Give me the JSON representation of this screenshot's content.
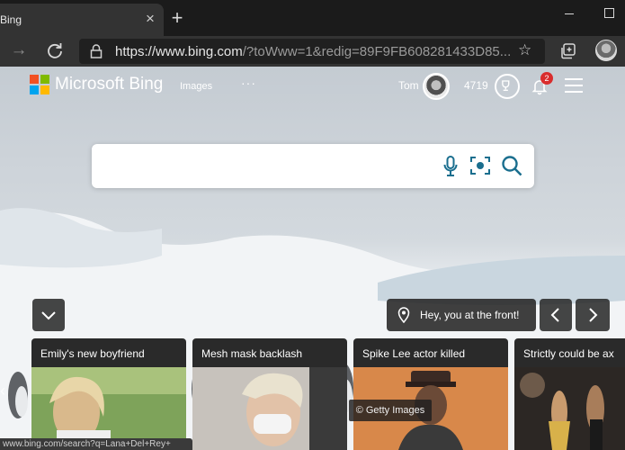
{
  "browser": {
    "tab_title": "Bing",
    "close_icon": "×",
    "new_tab_icon": "+",
    "url_main": "https://www.bing.com",
    "url_rest": "/?toWww=1&redig=89F9FB608281433D85...",
    "star_icon": "☆",
    "status_url": "www.bing.com/search?q=Lana+Del+Rey+"
  },
  "header": {
    "brand": "Microsoft Bing",
    "nav_images": "Images",
    "nav_more": "···",
    "user_name": "Tom",
    "points": "4719",
    "notification_count": "2",
    "logo_colors": [
      "#f25022",
      "#7fba00",
      "#00a4ef",
      "#ffb900"
    ]
  },
  "search": {
    "placeholder": "",
    "accent_color": "#1a6e8e"
  },
  "carousel": {
    "location_text": "Hey, you at the front!",
    "image_credit": "© Getty Images",
    "cards": [
      {
        "title": "Emily's new boyfriend"
      },
      {
        "title": "Mesh mask backlash"
      },
      {
        "title": "Spike Lee actor killed"
      },
      {
        "title": "Strictly could be ax"
      }
    ]
  }
}
